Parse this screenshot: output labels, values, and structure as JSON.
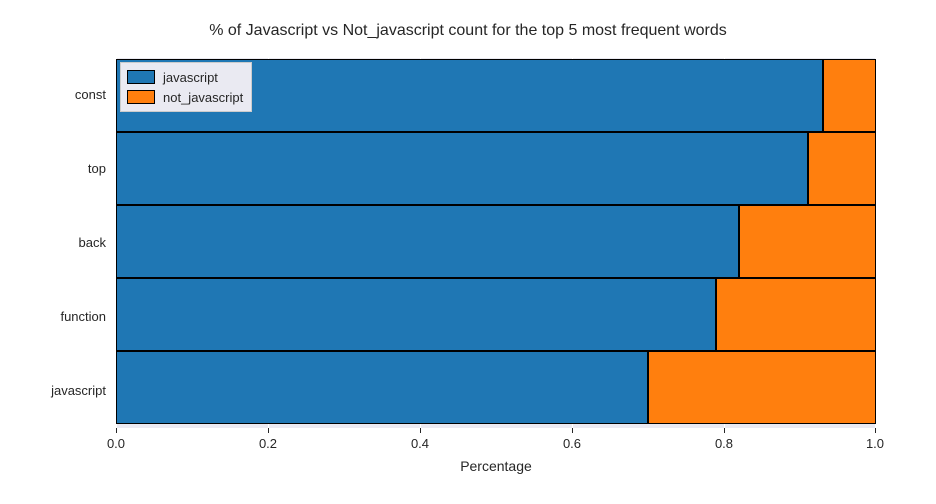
{
  "chart_data": {
    "type": "bar",
    "orientation": "horizontal",
    "stacked": true,
    "title": "% of Javascript vs Not_javascript count for the top 5 most frequent words",
    "xlabel": "Percentage",
    "ylabel": "",
    "xlim": [
      0.0,
      1.0
    ],
    "xticks": [
      0.0,
      0.2,
      0.4,
      0.6,
      0.8,
      1.0
    ],
    "categories": [
      "const",
      "top",
      "back",
      "function",
      "javascript"
    ],
    "series": [
      {
        "name": "javascript",
        "color": "#1f77b4",
        "values": [
          0.93,
          0.91,
          0.82,
          0.79,
          0.7
        ]
      },
      {
        "name": "not_javascript",
        "color": "#ff7f0e",
        "values": [
          0.07,
          0.09,
          0.18,
          0.21,
          0.3
        ]
      }
    ],
    "legend_position": "upper left"
  },
  "xtick_labels": {
    "t0": "0.0",
    "t1": "0.2",
    "t2": "0.4",
    "t3": "0.6",
    "t4": "0.8",
    "t5": "1.0"
  }
}
